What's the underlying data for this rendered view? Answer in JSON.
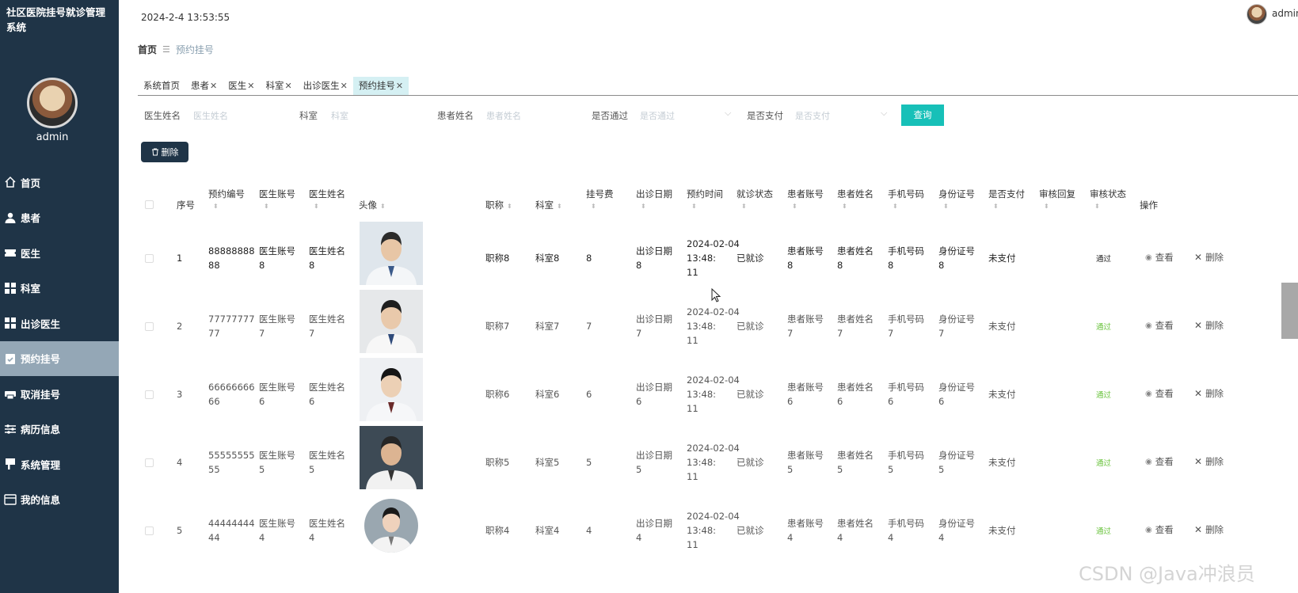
{
  "app": {
    "title": "社区医院挂号就诊管理系统",
    "admin_name": "admin",
    "datetime": "2024-2-4 13:53:55",
    "top_user": "admin"
  },
  "sidebar": {
    "items": [
      {
        "label": "首页",
        "icon": "home-icon",
        "active": false
      },
      {
        "label": "患者",
        "icon": "user-icon",
        "active": false
      },
      {
        "label": "医生",
        "icon": "ticket-icon",
        "active": false
      },
      {
        "label": "科室",
        "icon": "grid-icon",
        "active": false
      },
      {
        "label": "出诊医生",
        "icon": "grid-icon",
        "active": false
      },
      {
        "label": "预约挂号",
        "icon": "clipboard-icon",
        "active": true
      },
      {
        "label": "取消挂号",
        "icon": "printer-icon",
        "active": false
      },
      {
        "label": "病历信息",
        "icon": "sliders-icon",
        "active": false
      },
      {
        "label": "系统管理",
        "icon": "pin-icon",
        "active": false
      },
      {
        "label": "我的信息",
        "icon": "card-icon",
        "active": false
      }
    ]
  },
  "breadcrumb": {
    "home": "首页",
    "separator": "☰",
    "current": "预约挂号"
  },
  "tabs": [
    {
      "label": "系统首页",
      "closable": false,
      "active": false
    },
    {
      "label": "患者",
      "closable": true,
      "active": false
    },
    {
      "label": "医生",
      "closable": true,
      "active": false
    },
    {
      "label": "科室",
      "closable": true,
      "active": false
    },
    {
      "label": "出诊医生",
      "closable": true,
      "active": false
    },
    {
      "label": "预约挂号",
      "closable": true,
      "active": true
    }
  ],
  "filters": {
    "doctor_name": {
      "label": "医生姓名",
      "placeholder": "医生姓名"
    },
    "department": {
      "label": "科室",
      "placeholder": "科室"
    },
    "patient_name": {
      "label": "患者姓名",
      "placeholder": "患者姓名"
    },
    "approved": {
      "label": "是否通过",
      "placeholder": "是否通过"
    },
    "paid": {
      "label": "是否支付",
      "placeholder": "是否支付"
    },
    "query_label": "查询"
  },
  "toolbar": {
    "delete_label": "删除"
  },
  "table": {
    "headers": {
      "index": "序号",
      "appt_no": "预约编号",
      "doctor_account": "医生账号",
      "doctor_name": "医生姓名",
      "avatar": "头像",
      "title": "职称",
      "department": "科室",
      "fee": "挂号费",
      "visit_date": "出诊日期",
      "appt_time": "预约时间",
      "visit_status": "就诊状态",
      "patient_account": "患者账号",
      "patient_name": "患者姓名",
      "phone": "手机号码",
      "id_card": "身份证号",
      "paid": "是否支付",
      "review_reply": "审核回复",
      "review_status": "审核状态",
      "actions": "操作"
    },
    "view_label": "查看",
    "delete_label": "删除",
    "rows": [
      {
        "index": "1",
        "appt_no": "8888888888",
        "doctor_account": "医生账号8",
        "doctor_name": "医生姓名8",
        "title": "职称8",
        "department": "科室8",
        "fee": "8",
        "visit_date": "出诊日期8",
        "appt_time": "2024-02-04 13:48:11",
        "visit_status": "已就诊",
        "patient_account": "患者账号8",
        "patient_name": "患者姓名8",
        "phone": "手机号码8",
        "id_card": "身份证号8",
        "paid": "未支付",
        "review_reply": "",
        "review_status": "通过"
      },
      {
        "index": "2",
        "appt_no": "7777777777",
        "doctor_account": "医生账号7",
        "doctor_name": "医生姓名7",
        "title": "职称7",
        "department": "科室7",
        "fee": "7",
        "visit_date": "出诊日期7",
        "appt_time": "2024-02-04 13:48:11",
        "visit_status": "已就诊",
        "patient_account": "患者账号7",
        "patient_name": "患者姓名7",
        "phone": "手机号码7",
        "id_card": "身份证号7",
        "paid": "未支付",
        "review_reply": "",
        "review_status": "通过"
      },
      {
        "index": "3",
        "appt_no": "6666666666",
        "doctor_account": "医生账号6",
        "doctor_name": "医生姓名6",
        "title": "职称6",
        "department": "科室6",
        "fee": "6",
        "visit_date": "出诊日期6",
        "appt_time": "2024-02-04 13:48:11",
        "visit_status": "已就诊",
        "patient_account": "患者账号6",
        "patient_name": "患者姓名6",
        "phone": "手机号码6",
        "id_card": "身份证号6",
        "paid": "未支付",
        "review_reply": "",
        "review_status": "通过"
      },
      {
        "index": "4",
        "appt_no": "5555555555",
        "doctor_account": "医生账号5",
        "doctor_name": "医生姓名5",
        "title": "职称5",
        "department": "科室5",
        "fee": "5",
        "visit_date": "出诊日期5",
        "appt_time": "2024-02-04 13:48:11",
        "visit_status": "已就诊",
        "patient_account": "患者账号5",
        "patient_name": "患者姓名5",
        "phone": "手机号码5",
        "id_card": "身份证号5",
        "paid": "未支付",
        "review_reply": "",
        "review_status": "通过"
      },
      {
        "index": "5",
        "appt_no": "4444444444",
        "doctor_account": "医生账号4",
        "doctor_name": "医生姓名4",
        "title": "职称4",
        "department": "科室4",
        "fee": "4",
        "visit_date": "出诊日期4",
        "appt_time": "2024-02-04 13:48:11",
        "visit_status": "已就诊",
        "patient_account": "患者账号4",
        "patient_name": "患者姓名4",
        "phone": "手机号码4",
        "id_card": "身份证号4",
        "paid": "未支付",
        "review_reply": "",
        "review_status": "通过"
      }
    ]
  },
  "watermark": "CSDN @Java冲浪员"
}
